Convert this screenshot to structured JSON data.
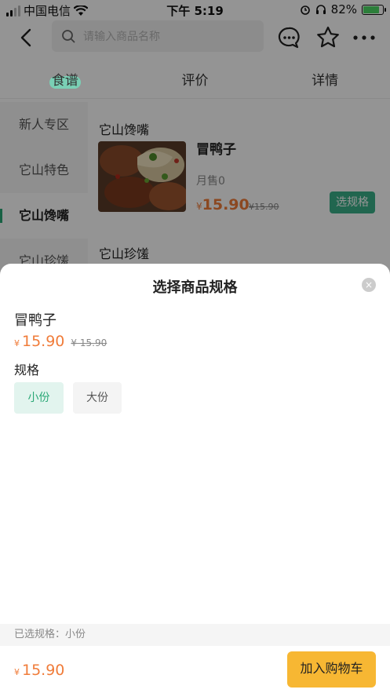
{
  "status": {
    "carrier": "中国电信",
    "time": "下午 5:19",
    "battery": "82%"
  },
  "header": {
    "search_placeholder": "请输入商品名称"
  },
  "tabs": [
    {
      "label": "食谱",
      "active": true
    },
    {
      "label": "评价",
      "active": false
    },
    {
      "label": "详情",
      "active": false
    }
  ],
  "sidebar": {
    "items": [
      {
        "label": "新人专区"
      },
      {
        "label": "它山特色"
      },
      {
        "label": "它山馋嘴"
      },
      {
        "label": "它山珍馐"
      }
    ]
  },
  "content": {
    "section1_title": "它山馋嘴",
    "section2_title": "它山珍馐",
    "item": {
      "name": "冒鸭子",
      "sales": "月售0",
      "currency": "¥",
      "price": "15.90",
      "old_price": "¥15.90",
      "button": "选规格"
    }
  },
  "sheet": {
    "title": "选择商品规格",
    "close": "×",
    "item_name": "冒鸭子",
    "currency": "¥",
    "price": "15.90",
    "old_price": "¥ 15.90",
    "spec_label": "规格",
    "options": [
      {
        "label": "小份",
        "selected": true
      },
      {
        "label": "大份",
        "selected": false
      }
    ],
    "selected_text": "已选规格：小份",
    "total_currency": "¥",
    "total": "15.90",
    "add_to_cart": "加入购物车"
  },
  "colors": {
    "accent_green": "#3ab089",
    "price_orange": "#f07c3a",
    "cart_yellow": "#f7b733"
  }
}
